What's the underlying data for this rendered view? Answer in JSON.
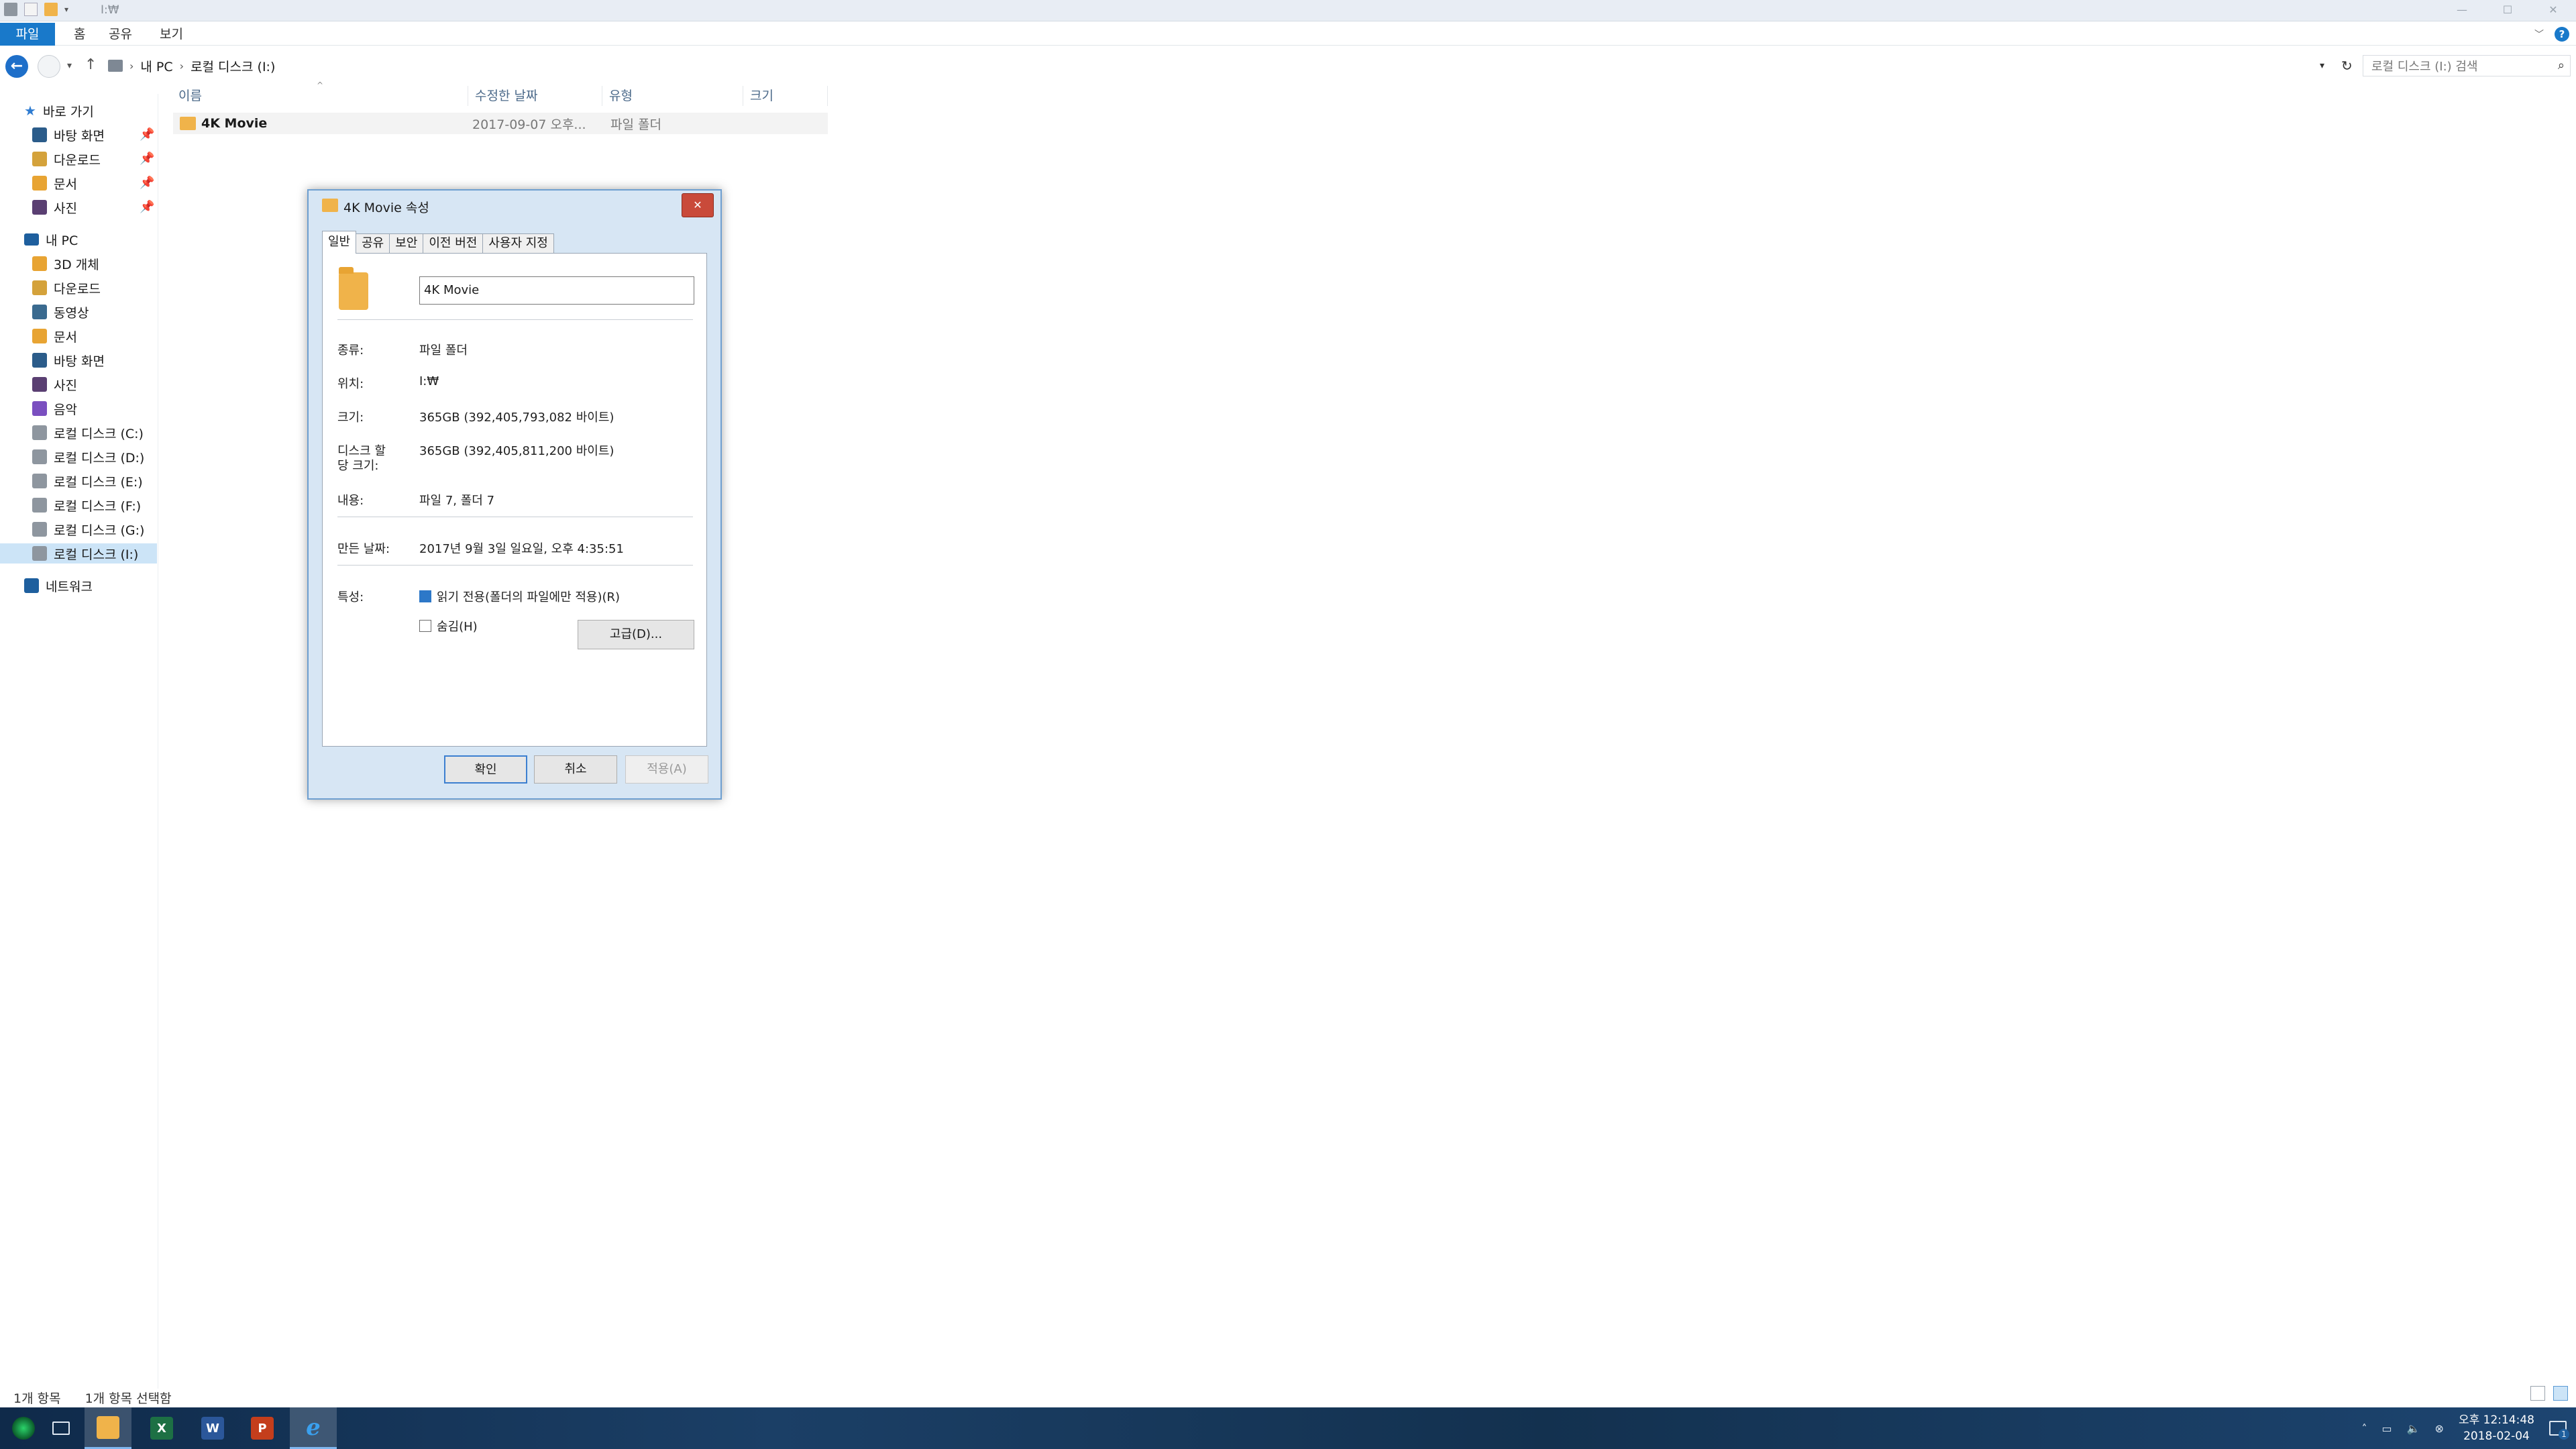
{
  "window": {
    "title": "I:₩",
    "controls": {
      "minimize": "—",
      "maximize": "☐",
      "close": "✕"
    }
  },
  "ribbon": {
    "tabs": [
      {
        "label": "파일"
      },
      {
        "label": "홈"
      },
      {
        "label": "공유"
      },
      {
        "label": "보기"
      }
    ],
    "help": "?"
  },
  "address": {
    "crumbs": [
      "내 PC",
      "로컬 디스크 (I:)"
    ],
    "search_placeholder": "로컬 디스크 (I:) 검색"
  },
  "nav": {
    "quick_access": "바로 가기",
    "quick_items": [
      {
        "label": "바탕 화면",
        "icon": "desktop-icon",
        "color": "#2b5c8a"
      },
      {
        "label": "다운로드",
        "icon": "download-icon",
        "color": "#d4a23b"
      },
      {
        "label": "문서",
        "icon": "documents-icon",
        "color": "#e8a433"
      },
      {
        "label": "사진",
        "icon": "pictures-icon",
        "color": "#5a3f72"
      }
    ],
    "this_pc": "내 PC",
    "pc_items": [
      {
        "label": "3D 개체",
        "icon": "3d-objects-icon",
        "color": "#e8a433"
      },
      {
        "label": "다운로드",
        "icon": "download-icon",
        "color": "#d4a23b"
      },
      {
        "label": "동영상",
        "icon": "videos-icon",
        "color": "#3a6a8f"
      },
      {
        "label": "문서",
        "icon": "documents-icon",
        "color": "#e8a433"
      },
      {
        "label": "바탕 화면",
        "icon": "desktop-icon",
        "color": "#2b5c8a"
      },
      {
        "label": "사진",
        "icon": "pictures-icon",
        "color": "#5a3f72"
      },
      {
        "label": "음악",
        "icon": "music-icon",
        "color": "#7a4fc0"
      },
      {
        "label": "로컬 디스크 (C:)",
        "icon": "drive-icon",
        "color": "#8e969f"
      },
      {
        "label": "로컬 디스크 (D:)",
        "icon": "drive-icon",
        "color": "#8e969f"
      },
      {
        "label": "로컬 디스크 (E:)",
        "icon": "drive-icon",
        "color": "#8e969f"
      },
      {
        "label": "로컬 디스크 (F:)",
        "icon": "drive-icon",
        "color": "#8e969f"
      },
      {
        "label": "로컬 디스크 (G:)",
        "icon": "drive-icon",
        "color": "#8e969f"
      },
      {
        "label": "로컬 디스크 (I:)",
        "icon": "drive-icon",
        "color": "#8e969f",
        "selected": true
      }
    ],
    "network": "네트워크"
  },
  "list": {
    "columns": [
      "이름",
      "수정한 날짜",
      "유형",
      "크기"
    ],
    "rows": [
      {
        "name": "4K Movie",
        "date": "2017-09-07 오후...",
        "type": "파일 폴더",
        "size": ""
      }
    ]
  },
  "dialog": {
    "title": "4K Movie 속성",
    "close": "✕",
    "tabs": [
      "일반",
      "공유",
      "보안",
      "이전 버전",
      "사용자 지정"
    ],
    "active_tab": "일반",
    "name_value": "4K Movie",
    "fields": {
      "type_label": "종류:",
      "type_value": "파일 폴더",
      "location_label": "위치:",
      "location_value": "I:₩",
      "size_label": "크기:",
      "size_value": "365GB (392,405,793,082 바이트)",
      "disk_label_1": "디스크 할",
      "disk_label_2": "당 크기:",
      "disk_value": "365GB (392,405,811,200 바이트)",
      "contents_label": "내용:",
      "contents_value": "파일 7, 폴더 7",
      "created_label": "만든 날짜:",
      "created_value": "2017년 9월 3일 일요일, 오후 4:35:51",
      "attributes_label": "특성:"
    },
    "readonly_label": "읽기 전용(폴더의 파일에만 적용)(R)",
    "hidden_label": "숨김(H)",
    "advanced_button": "고급(D)...",
    "ok": "확인",
    "cancel": "취소",
    "apply": "적용(A)"
  },
  "status": {
    "count": "1개 항목",
    "selected": "1개 항목 선택함"
  },
  "taskbar": {
    "apps": [
      {
        "name": "start",
        "label": ""
      },
      {
        "name": "task-view",
        "label": ""
      },
      {
        "name": "file-explorer",
        "label": ""
      },
      {
        "name": "excel",
        "label": "X"
      },
      {
        "name": "word",
        "label": "W"
      },
      {
        "name": "powerpoint",
        "label": "P"
      },
      {
        "name": "internet-explorer",
        "label": "e"
      }
    ],
    "clock_time": "오후 12:14:48",
    "clock_date": "2018-02-04",
    "notification_count": "1"
  }
}
